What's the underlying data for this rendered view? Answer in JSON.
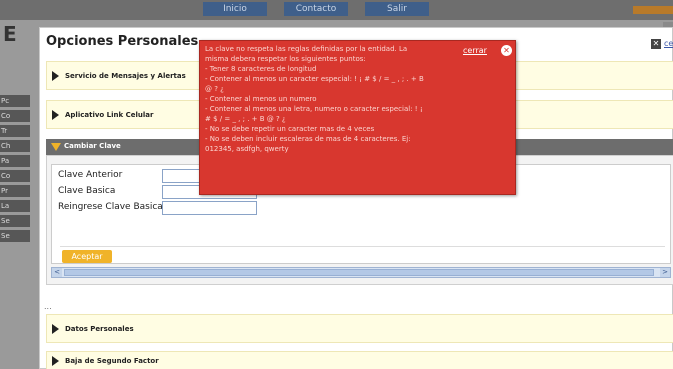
{
  "background": {
    "nav": [
      "Inicio",
      "Contacto",
      "Salir"
    ],
    "logo_letter": "E",
    "sidebar": [
      "Pc",
      "Co",
      "Tr",
      "Ch",
      "Pa",
      "Co",
      "Pr",
      "La",
      "Se",
      "Se"
    ]
  },
  "modal": {
    "title": "Opciones Personales",
    "close_label": "cerrar",
    "sections": [
      {
        "label": "Servicio de Mensajes y Alertas"
      },
      {
        "label": "Aplicativo Link Celular"
      }
    ],
    "open_section": {
      "label": "Cambiar Clave",
      "fields": [
        {
          "label": "Clave Anterior",
          "value": ""
        },
        {
          "label": "Clave Basica",
          "value": ""
        },
        {
          "label": "Reingrese Clave Basica",
          "value": ""
        }
      ],
      "accept_label": "Aceptar"
    },
    "ellipsis": "...",
    "lower_sections": [
      {
        "label": "Datos Personales"
      },
      {
        "label": "Baja de Segundo Factor"
      }
    ]
  },
  "error_popup": {
    "close_label": "cerrar",
    "lines": [
      "La clave no respeta las reglas definidas por la entidad. La",
      "misma debera respetar los siguientes puntos:",
      "- Tener 8 caracteres de longitud",
      "- Contener al menos un caracter especial: ! ¡ # $ / = _ , ; . + B",
      "@ ? ¿",
      "- Contener al menos un numero",
      "- Contener al menos una letra, numero o caracter especial: ! ¡",
      "# $ / = _ , ; . + B @ ? ¿",
      "- No se debe repetir un caracter mas de 4 veces",
      "- No se deben incluir escaleras de mas de 4 caracteres. Ej:",
      "012345, asdfgh, qwerty"
    ]
  },
  "colors": {
    "error_bg": "#d8372f",
    "section_bg": "#fffde3",
    "header_gray": "#6d6d6d",
    "accent_orange": "#f0b329"
  }
}
